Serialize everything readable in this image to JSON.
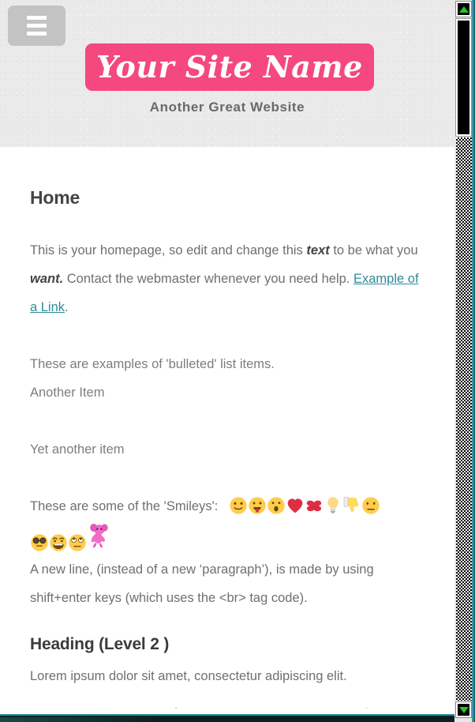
{
  "header": {
    "menu_button_label": "Menu",
    "site_title": "Your Site Name",
    "tagline": "Another Great Website"
  },
  "content": {
    "page_heading": "Home",
    "intro": {
      "part1": "This is your homepage, so edit and change this ",
      "bold1": "text",
      "part2": " to be what you ",
      "bold2": "want.",
      "part3": "  Contact the webmaster whenever you need help. ",
      "link_text": "Example of a Link",
      "part4": "."
    },
    "list_items": [
      "These are examples of 'bulleted' list items.",
      "Another Item",
      "Yet another item"
    ],
    "smileys_label": "These are some of the 'Smileys':",
    "smileys_row1": [
      "slightly-smiling-face-emoji",
      "face-with-tongue-emoji",
      "surprised-face-emoji",
      "red-heart-emoji",
      "kiss-mark-emoji",
      "light-bulb-emoji",
      "thumbs-down-emoji",
      "neutral-face-emoji"
    ],
    "smileys_row2": [
      "sunglasses-face-emoji",
      "grinning-face-emoji",
      "rolling-eyes-face-emoji",
      "pink-dancing-elephant-emoji"
    ],
    "newline_note": "A new line, (instead of a new ‘paragraph’), is made by using shift+enter keys (which uses the <br> tag code).",
    "heading_level2": "Heading (Level 2 )",
    "lorem_line1": "Lorem ipsum dolor sit amet, consectetur adipiscing elit.",
    "lorem_line2_clipped": "Donec ultricies ac arcu eget rutrum. Phasellus sit ullamcorper"
  },
  "scrollbar": {
    "up_arrow": "scroll-up-arrow-icon",
    "down_arrow": "scroll-down-arrow-icon"
  },
  "colors": {
    "banner_pink": "#f4487f",
    "link_teal": "#2e8b9a",
    "header_gray": "#eaeaea",
    "menu_button_gray": "#c3c3c3",
    "tagline_gray": "#696969",
    "body_text_gray": "#6f6f6f",
    "scroll_arrow_green": "#22c722",
    "bottom_strip_teal": "#2a8a93"
  }
}
